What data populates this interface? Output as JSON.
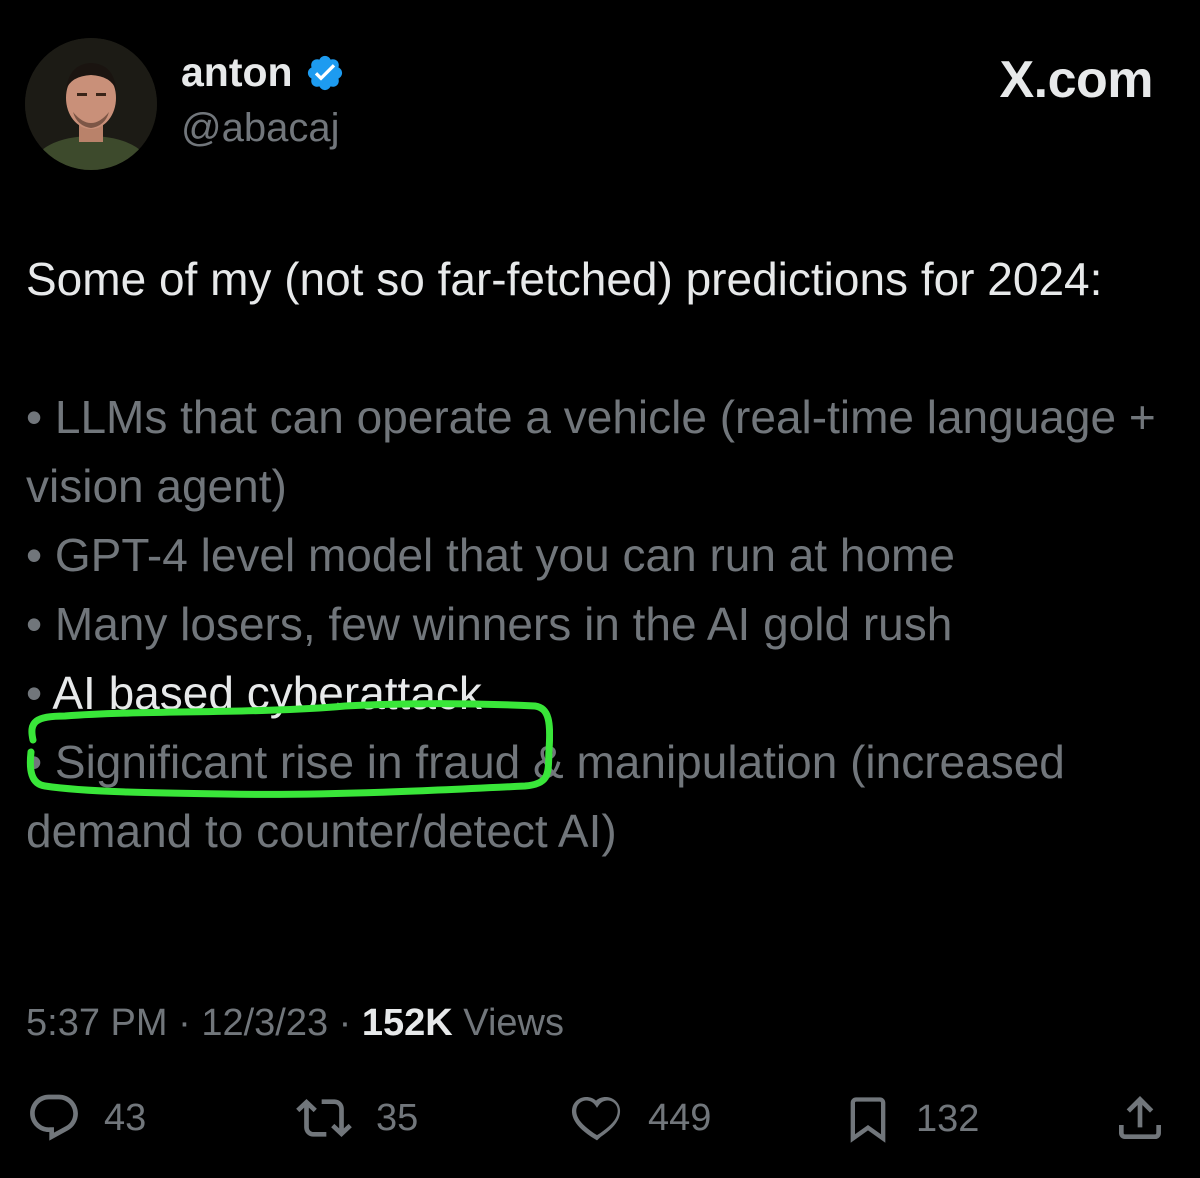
{
  "author": {
    "display_name": "anton",
    "handle": "@abacaj",
    "verified_color": "#1d9bf0"
  },
  "site_label": "X.com",
  "tweet": {
    "intro": "Some of my (not so far-fetched) predictions for 2024:",
    "bullet": "•",
    "bullets": [
      "LLMs that can operate a vehicle (real-time language + vision agent)",
      "GPT-4 level model that you can run at home",
      "Many losers, few winners in the AI gold rush",
      "AI based cyberattack",
      "Significant rise in fraud & manipulation (increased demand to counter/detect AI)"
    ],
    "highlighted_index": 3,
    "highlight_color": "#39e639"
  },
  "meta": {
    "time": "5:37 PM",
    "separator": "·",
    "date": "12/3/23",
    "views_count": "152K",
    "views_label": "Views"
  },
  "actions": {
    "replies": "43",
    "reposts": "35",
    "likes": "449",
    "bookmarks": "132"
  },
  "icons": [
    "verified-badge-icon",
    "reply-icon",
    "repost-icon",
    "like-icon",
    "bookmark-icon",
    "share-icon"
  ]
}
